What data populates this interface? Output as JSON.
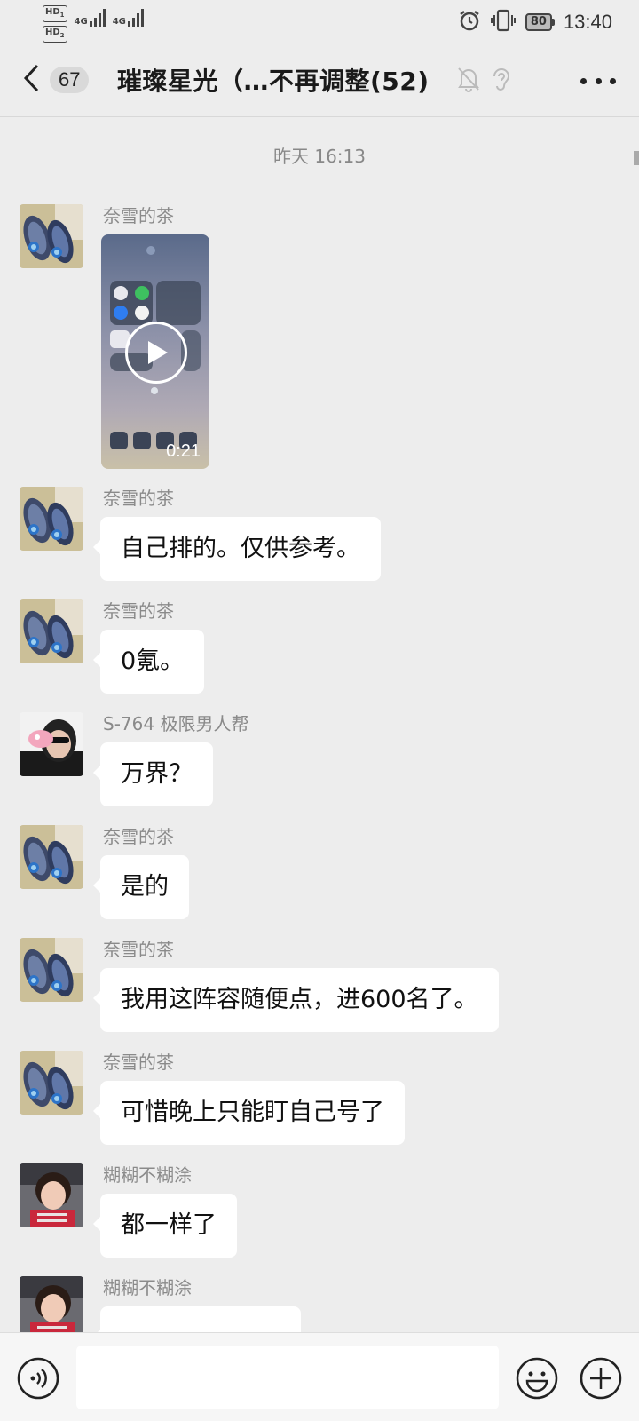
{
  "status_bar": {
    "hd1": "HD",
    "hd1_sub": "1",
    "hd2": "HD",
    "hd2_sub": "2",
    "net1": "4G",
    "net2": "4G",
    "battery": "80",
    "time": "13:40",
    "icons": [
      "alarm-icon",
      "vibrate-icon"
    ]
  },
  "nav": {
    "unread_count": "67",
    "title": "璀璨星光（…不再调整(52)",
    "icons": [
      "back-arrow-icon",
      "mute-bell-icon",
      "ear-icon",
      "more-icon"
    ]
  },
  "chat": {
    "time_separator": "昨天 16:13",
    "messages": [
      {
        "sender": "奈雪的茶",
        "type": "video",
        "duration": "0:21"
      },
      {
        "sender": "奈雪的茶",
        "text": "自己排的。仅供参考。"
      },
      {
        "sender": "奈雪的茶",
        "text": "0氪。"
      },
      {
        "sender": "S-764 极限男人帮",
        "text": "万界？"
      },
      {
        "sender": "奈雪的茶",
        "text": "是的"
      },
      {
        "sender": "奈雪的茶",
        "text": "我用这阵容随便点，进600名了。"
      },
      {
        "sender": "奈雪的茶",
        "text": "可惜晚上只能盯自己号了"
      },
      {
        "sender": "糊糊不糊涂",
        "text": "都一样了"
      },
      {
        "sender": "糊糊不糊涂",
        "text": ""
      }
    ]
  },
  "input_bar": {
    "placeholder": "",
    "icons": [
      "voice-icon",
      "emoji-icon",
      "plus-icon"
    ]
  },
  "colors": {
    "background": "#ededed",
    "bubble": "#ffffff",
    "sender_text": "#8a8a8a"
  }
}
